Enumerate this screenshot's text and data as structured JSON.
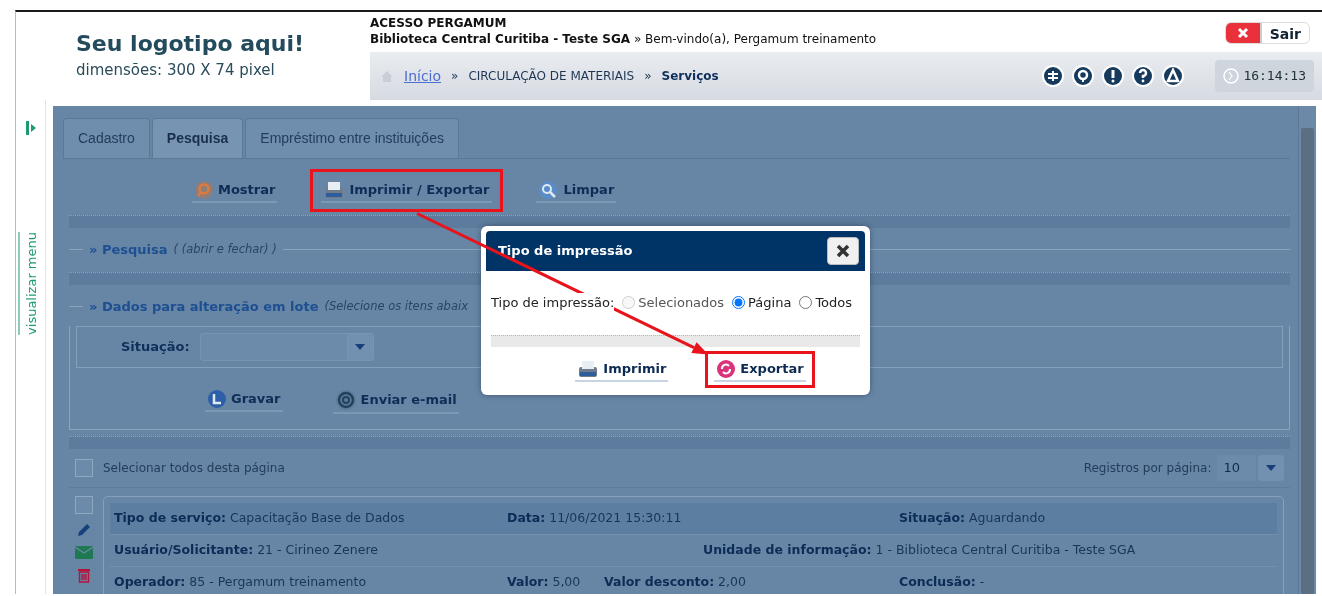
{
  "header": {
    "logo_title": "Seu logotipo aqui!",
    "logo_subtitle": "dimensões: 300 X 74 pixel",
    "system_title": "ACESSO PERGAMUM",
    "library_line": "**Biblioteca Central Curitiba - Teste SGA** » Bem-vindo(a), Pergamum treinamento",
    "logout": "Sair",
    "clock": "16:14:13",
    "breadcrumb": [
      {
        "label": "Início",
        "kind": "link"
      },
      {
        "label": "»",
        "kind": "separator"
      },
      {
        "label": "CIRCULAÇÃO DE MATERIAIS",
        "kind": "text"
      },
      {
        "label": "»",
        "kind": "separator"
      },
      {
        "label": "Serviços",
        "kind": "current"
      }
    ]
  },
  "side_menu": {
    "label": "visualizar menu"
  },
  "tabs": [
    {
      "label": "Cadastro",
      "selected": false
    },
    {
      "label": "Pesquisa",
      "selected": true
    },
    {
      "label": "Empréstimo entre instituições",
      "selected": false
    }
  ],
  "toolbar": [
    {
      "label": "Mostrar",
      "kind": "show",
      "highlighted": false
    },
    {
      "label": "Imprimir / Exportar",
      "kind": "print",
      "highlighted": true
    },
    {
      "label": "Limpar",
      "kind": "clear",
      "highlighted": false
    }
  ],
  "search_section": {
    "title": "» Pesquisa",
    "hint": "( (abrir e fechar) )"
  },
  "batch_section": {
    "title": "» Dados para alteração em lote",
    "hint": "(Selecione os itens abaix",
    "situation_label": "Situação:",
    "actions": [
      {
        "label": "Gravar",
        "kind": "save",
        "highlighted": false
      },
      {
        "label": "Enviar e-mail",
        "kind": "email",
        "highlighted": false
      }
    ]
  },
  "list": {
    "select_all_label": "Selecionar todos desta página",
    "select_all_checked": false,
    "per_page_label": "Registros por página:",
    "per_page": "10"
  },
  "records": [
    {
      "checked": false,
      "rows": [
        [
          "**Tipo de serviço:** Capacitação Base de Dados",
          "**Data:** 11/06/2021 15:30:11",
          "",
          "**Situação:** Aguardando"
        ],
        [
          "**Usuário/Solicitante:** 21 - Cirineo Zenere",
          "",
          "**Unidade de informação:** 1 - Biblioteca Central Curitiba - Teste SGA"
        ],
        [
          "**Operador:** 85 - Pergamum treinamento",
          "**Valor:** 5,00",
          "**Valor desconto:** 2,00",
          "**Conclusão:** -"
        ]
      ]
    }
  ],
  "dialog": {
    "title": "Tipo de impressão",
    "field_label": "Tipo de impressão:",
    "options": [
      {
        "label": "Selecionados",
        "selected": false,
        "disabled": true
      },
      {
        "label": "Página",
        "selected": true,
        "disabled": false
      },
      {
        "label": "Todos",
        "selected": false,
        "disabled": false
      }
    ],
    "buttons": [
      {
        "label": "Imprimir",
        "kind": "print",
        "highlighted": false
      },
      {
        "label": "Exportar",
        "kind": "export",
        "highlighted": true
      }
    ]
  }
}
